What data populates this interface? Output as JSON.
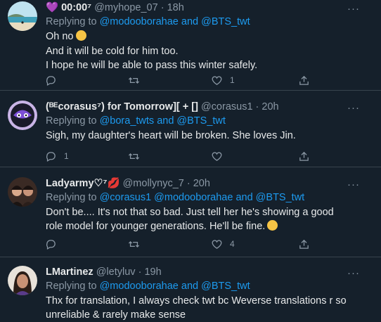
{
  "tweets": [
    {
      "name": "💜 00:00⁷",
      "handle": "@myhope_07",
      "time": "18h",
      "reply_prefix": "Replying to ",
      "reply_to": "@modooborahae and @BTS_twt",
      "text": "Oh no",
      "text_rest": "And it will be cold for him too.\nI hope he will be able to pass this winter safely.",
      "replies": "",
      "retweets": "",
      "likes": "1"
    },
    {
      "name": "(ᴮᴱcorasus⁷) for Tomorrow][ + []",
      "handle": "@corasus1",
      "time": "20h",
      "reply_prefix": "Replying to ",
      "reply_to": "@bora_twts and @BTS_twt",
      "text": "Sigh, my daughter's heart will be broken. She loves Jin.",
      "replies": "1",
      "retweets": "",
      "likes": ""
    },
    {
      "name": "Ladyarmy♡⁷💋",
      "handle": "@mollynyc_7",
      "time": "20h",
      "reply_prefix": "Replying to ",
      "reply_to": "@corasus1 @modooborahae and @BTS_twt",
      "text": "Don't be.... It's not that so bad. Just tell her he's showing a good role model for younger generations. He'll be fine.",
      "replies": "",
      "retweets": "",
      "likes": "4"
    },
    {
      "name": "LMartinez",
      "handle": "@letyluv",
      "time": "19h",
      "reply_prefix": "Replying to ",
      "reply_to": "@modooborahae and @BTS_twt",
      "text": "Thx for translation, I always check twt bc Weverse translations r so unreliable & rarely make sense"
    }
  ],
  "separator": "·",
  "more": "···",
  "icons": {
    "reply": "reply-icon",
    "retweet": "retweet-icon",
    "like": "like-icon",
    "share": "share-icon"
  },
  "colors": {
    "background": "#15202b",
    "link": "#1d9bf0",
    "muted": "#8b98a5",
    "text": "#e7e9ea"
  }
}
